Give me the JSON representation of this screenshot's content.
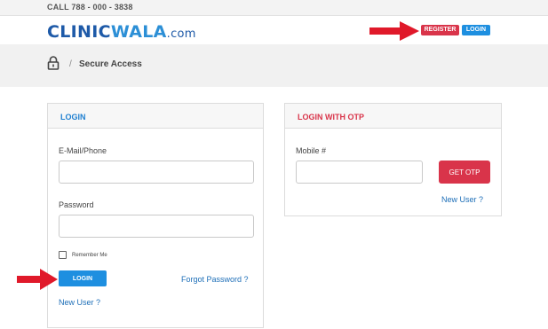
{
  "topbar": {
    "call": "CALL 788 - 000 - 3838"
  },
  "header": {
    "logo_clinic": "CLINIC",
    "logo_wala": "WALA",
    "logo_dotcom": ".com",
    "register_label": "REGISTER",
    "login_label": "LOGIN"
  },
  "breadcrumb": {
    "separator": "/",
    "title": "Secure Access"
  },
  "login_panel": {
    "title": "LOGIN",
    "email_label": "E-Mail/Phone",
    "email_value": "",
    "password_label": "Password",
    "password_value": "",
    "remember_label": "Remember Me",
    "remember_checked": false,
    "login_button": "LOGIN",
    "forgot_link": "Forgot Password ?",
    "new_user_link": "New User ?"
  },
  "otp_panel": {
    "title": "LOGIN WITH OTP",
    "mobile_label": "Mobile #",
    "mobile_value": "",
    "get_otp_button": "GET OTP",
    "new_user_link": "New User ?"
  },
  "colors": {
    "accent_blue": "#1e8fe0",
    "accent_red": "#d9344a",
    "arrow_red": "#e0192a",
    "logo_dark": "#1e5aa8",
    "logo_light": "#2c8fd6"
  },
  "icons": {
    "breadcrumb": "lock-icon",
    "pointer": "red-arrow-icon"
  }
}
